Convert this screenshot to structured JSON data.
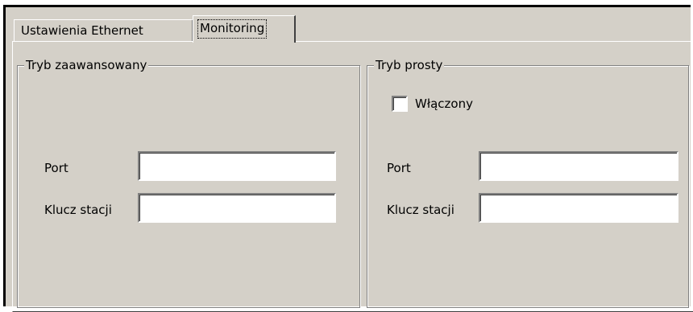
{
  "tabs": [
    {
      "label": "Ustawienia Ethernet",
      "selected": false
    },
    {
      "label": "Monitoring",
      "selected": true
    }
  ],
  "advanced": {
    "title": "Tryb zaawansowany",
    "port_label": "Port",
    "port_value": "",
    "station_key_label": "Klucz stacji",
    "station_key_value": ""
  },
  "simple": {
    "title": "Tryb prosty",
    "enabled_label": "Włączony",
    "enabled": false,
    "port_label": "Port",
    "port_value": "",
    "station_key_label": "Klucz stacji",
    "station_key_value": ""
  },
  "colors": {
    "face": "#d4d0c8",
    "shadow": "#808080",
    "dark_shadow": "#404040",
    "highlight": "#ffffff"
  }
}
